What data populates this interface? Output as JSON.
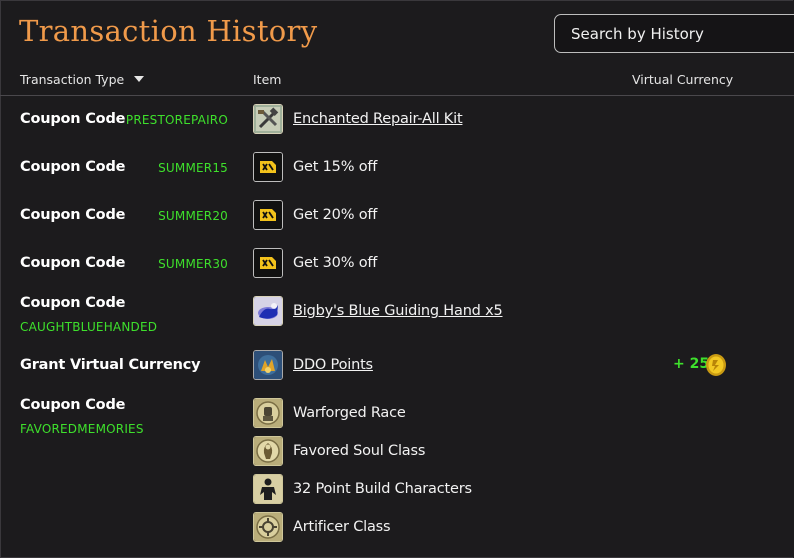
{
  "page": {
    "title": "Transaction History"
  },
  "search": {
    "placeholder": "Search by History"
  },
  "columns": {
    "type": "Transaction Type",
    "item": "Item",
    "currency": "Virtual Currency"
  },
  "rows": [
    {
      "type": "Coupon Code",
      "code": "PRESTOREPAIRO",
      "items": [
        {
          "label": "Enchanted Repair-All Kit",
          "icon": "repair-kit-icon",
          "link": true
        }
      ]
    },
    {
      "type": "Coupon Code",
      "code": "SUMMER15",
      "items": [
        {
          "label": "Get 15% off",
          "icon": "discount-ticket-icon",
          "link": false
        }
      ]
    },
    {
      "type": "Coupon Code",
      "code": "SUMMER20",
      "items": [
        {
          "label": "Get 20% off",
          "icon": "discount-ticket-icon",
          "link": false
        }
      ]
    },
    {
      "type": "Coupon Code",
      "code": "SUMMER30",
      "items": [
        {
          "label": "Get 30% off",
          "icon": "discount-ticket-icon",
          "link": false
        }
      ]
    },
    {
      "type": "Coupon Code",
      "code": "CAUGHTBLUEHANDED",
      "items": [
        {
          "label": "Bigby's Blue Guiding Hand x5",
          "icon": "blue-hand-icon",
          "link": true
        }
      ]
    },
    {
      "type": "Grant Virtual Currency",
      "code": "",
      "currency": "+ 25",
      "currency_icon": "ddo-point-coin-icon",
      "items": [
        {
          "label": "DDO Points",
          "icon": "ddo-points-icon",
          "link": true
        }
      ]
    },
    {
      "type": "Coupon Code",
      "code": "FAVOREDMEMORIES",
      "items": [
        {
          "label": "Warforged Race",
          "icon": "warforged-race-icon",
          "link": false
        },
        {
          "label": "Favored Soul Class",
          "icon": "favored-soul-class-icon",
          "link": false
        },
        {
          "label": "32 Point Build Characters",
          "icon": "point-build-icon",
          "link": false
        },
        {
          "label": "Artificer Class",
          "icon": "artificer-class-icon",
          "link": false
        }
      ]
    }
  ],
  "colors": {
    "title": "#f09a4a",
    "code": "#3ee02c",
    "background": "#1c1b1d"
  }
}
